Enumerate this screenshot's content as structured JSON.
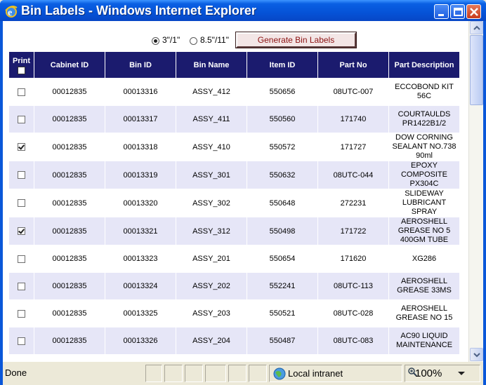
{
  "window": {
    "title": "Bin Labels - Windows Internet Explorer",
    "icon": "ie-icon"
  },
  "controls": {
    "radio_options": [
      {
        "label": "3\"/1\"",
        "selected": true
      },
      {
        "label": "8.5\"/11\"",
        "selected": false
      }
    ],
    "generate_label": "Generate Bin Labels"
  },
  "table": {
    "headers": {
      "print": "Print",
      "cabinet_id": "Cabinet ID",
      "bin_id": "Bin ID",
      "bin_name": "Bin Name",
      "item_id": "Item ID",
      "part_no": "Part No",
      "part_description": "Part Description"
    },
    "header_checkbox_checked": false,
    "rows": [
      {
        "checked": false,
        "cabinet_id": "00012835",
        "bin_id": "00013316",
        "bin_name": "ASSY_412",
        "item_id": "550656",
        "part_no": "08UTC-007",
        "description": "ECCOBOND KIT 56C"
      },
      {
        "checked": false,
        "cabinet_id": "00012835",
        "bin_id": "00013317",
        "bin_name": "ASSY_411",
        "item_id": "550560",
        "part_no": "171740",
        "description": "COURTAULDS PR1422B1/2"
      },
      {
        "checked": true,
        "cabinet_id": "00012835",
        "bin_id": "00013318",
        "bin_name": "ASSY_410",
        "item_id": "550572",
        "part_no": "171727",
        "description": "DOW CORNING SEALANT NO.738 90ml"
      },
      {
        "checked": false,
        "cabinet_id": "00012835",
        "bin_id": "00013319",
        "bin_name": "ASSY_301",
        "item_id": "550632",
        "part_no": "08UTC-044",
        "description": "EPOXY COMPOSITE PX304C"
      },
      {
        "checked": false,
        "cabinet_id": "00012835",
        "bin_id": "00013320",
        "bin_name": "ASSY_302",
        "item_id": "550648",
        "part_no": "272231",
        "description": "SLIDEWAY LUBRICANT SPRAY"
      },
      {
        "checked": true,
        "cabinet_id": "00012835",
        "bin_id": "00013321",
        "bin_name": "ASSY_312",
        "item_id": "550498",
        "part_no": "171722",
        "description": "AEROSHELL GREASE NO 5 400GM TUBE"
      },
      {
        "checked": false,
        "cabinet_id": "00012835",
        "bin_id": "00013323",
        "bin_name": "ASSY_201",
        "item_id": "550654",
        "part_no": "171620",
        "description": "XG286"
      },
      {
        "checked": false,
        "cabinet_id": "00012835",
        "bin_id": "00013324",
        "bin_name": "ASSY_202",
        "item_id": "552241",
        "part_no": "08UTC-113",
        "description": "AEROSHELL GREASE 33MS"
      },
      {
        "checked": false,
        "cabinet_id": "00012835",
        "bin_id": "00013325",
        "bin_name": "ASSY_203",
        "item_id": "550521",
        "part_no": "08UTC-028",
        "description": "AEROSHELL GREASE NO 15"
      },
      {
        "checked": false,
        "cabinet_id": "00012835",
        "bin_id": "00013326",
        "bin_name": "ASSY_204",
        "item_id": "550487",
        "part_no": "08UTC-083",
        "description": "AC90 LIQUID MAINTENANCE"
      }
    ]
  },
  "status": {
    "text": "Done",
    "zone": "Local intranet",
    "zoom": "100%"
  },
  "colors": {
    "header_bg": "#1b1b6e",
    "alt_row_bg": "#e6e6f7",
    "titlebar": "#0553d7",
    "button_text": "#8b1010"
  }
}
